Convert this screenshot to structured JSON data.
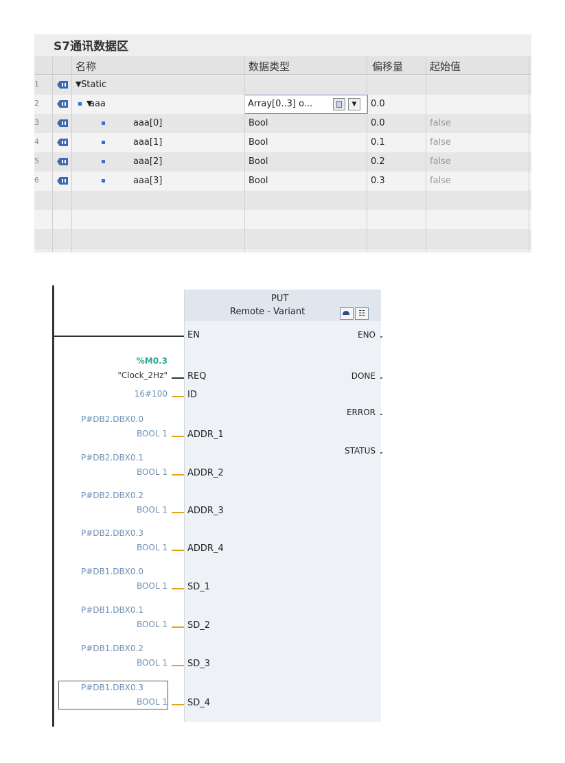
{
  "db_table": {
    "title": "S7通讯数据区",
    "columns": [
      "名称",
      "数据类型",
      "偏移量",
      "起始值"
    ],
    "rows": [
      {
        "num": "1",
        "expander": "▼",
        "name": "Static",
        "type": "",
        "offset": "",
        "start": ""
      },
      {
        "num": "2",
        "expander": "▼",
        "name": "aaa",
        "type": "Array[0..3] o...",
        "offset": "0.0",
        "start": ""
      },
      {
        "num": "3",
        "expander": "",
        "name": "aaa[0]",
        "type": "Bool",
        "offset": "0.0",
        "start": "false"
      },
      {
        "num": "4",
        "expander": "",
        "name": "aaa[1]",
        "type": "Bool",
        "offset": "0.1",
        "start": "false"
      },
      {
        "num": "5",
        "expander": "",
        "name": "aaa[2]",
        "type": "Bool",
        "offset": "0.2",
        "start": "false"
      },
      {
        "num": "6",
        "expander": "",
        "name": "aaa[3]",
        "type": "Bool",
        "offset": "0.3",
        "start": "false"
      }
    ]
  },
  "function_block": {
    "name": "PUT",
    "subtitle": "Remote - Variant",
    "inputs": [
      {
        "pin": "EN",
        "param1": "",
        "param2": ""
      },
      {
        "pin": "REQ",
        "param1": "%M0.3",
        "param2": "\"Clock_2Hz\""
      },
      {
        "pin": "ID",
        "param1": "",
        "param2": "16#100"
      },
      {
        "pin": "ADDR_1",
        "param1": "P#DB2.DBX0.0",
        "param2": "BOOL 1"
      },
      {
        "pin": "ADDR_2",
        "param1": "P#DB2.DBX0.1",
        "param2": "BOOL 1"
      },
      {
        "pin": "ADDR_3",
        "param1": "P#DB2.DBX0.2",
        "param2": "BOOL 1"
      },
      {
        "pin": "ADDR_4",
        "param1": "P#DB2.DBX0.3",
        "param2": "BOOL 1"
      },
      {
        "pin": "SD_1",
        "param1": "P#DB1.DBX0.0",
        "param2": "BOOL 1"
      },
      {
        "pin": "SD_2",
        "param1": "P#DB1.DBX0.1",
        "param2": "BOOL 1"
      },
      {
        "pin": "SD_3",
        "param1": "P#DB1.DBX0.2",
        "param2": "BOOL 1"
      },
      {
        "pin": "SD_4",
        "param1": "P#DB1.DBX0.3",
        "param2": "BOOL 1"
      }
    ],
    "outputs": [
      "ENO",
      "DONE",
      "ERROR",
      "STATUS"
    ],
    "header_icons": [
      "network-icon",
      "parameter-icon"
    ]
  },
  "colors": {
    "param_blue": "#6c8fb3",
    "address_green": "#2aa595",
    "wire_orange": "#e5a317",
    "block_bg": "#eef2f6"
  }
}
